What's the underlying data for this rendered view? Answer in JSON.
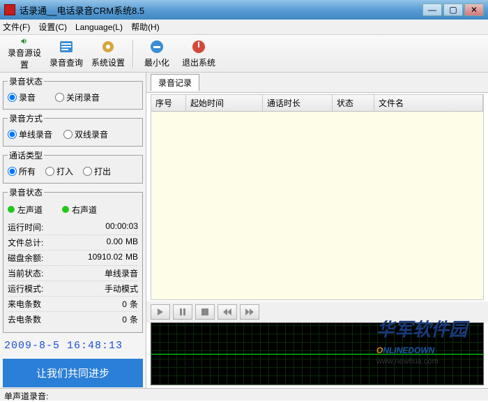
{
  "window": {
    "title": "话录通__电话录音CRM系统8.5"
  },
  "menu": {
    "file": "文件(F)",
    "settings": "设置(C)",
    "language": "Language(L)",
    "help": "帮助(H)"
  },
  "toolbar": {
    "src": "录音源设置",
    "query": "录音查询",
    "sys": "系统设置",
    "min": "最小化",
    "exit": "退出系统"
  },
  "groups": {
    "recstate": "录音状态",
    "recmode": "录音方式",
    "calltype": "通话类型",
    "chstate": "录音状态"
  },
  "radio": {
    "rec": "录音",
    "close": "关闭录音",
    "single": "单线录音",
    "dual": "双线录音",
    "all": "所有",
    "in": "打入",
    "out": "打出"
  },
  "channel": {
    "left": "左声道",
    "right": "右声道"
  },
  "stats": {
    "runtime_l": "运行时间:",
    "runtime_v": "00:00:03",
    "files_l": "文件总计:",
    "files_v": "0.00",
    "files_u": "MB",
    "disk_l": "磁盘余额:",
    "disk_v": "10910.02",
    "disk_u": "MB",
    "cur_l": "当前状态:",
    "cur_v": "单线录音",
    "mode_l": "运行模式:",
    "mode_v": "手动模式",
    "incount_l": "来电条数",
    "incount_v": "0",
    "incount_u": "条",
    "outcount_l": "去电条数",
    "outcount_v": "0",
    "outcount_u": "条"
  },
  "datetime": "2009-8-5  16:48:13",
  "bluebtn": "让我们共同进步",
  "rlist": {
    "tab": "录音记录",
    "cols": {
      "seq": "序号",
      "start": "起始时间",
      "dur": "通话时长",
      "state": "状态",
      "fname": "文件名"
    }
  },
  "logo": {
    "zh": "华军软件园",
    "url": "www.newhua.com"
  },
  "status": "单声道录音:"
}
